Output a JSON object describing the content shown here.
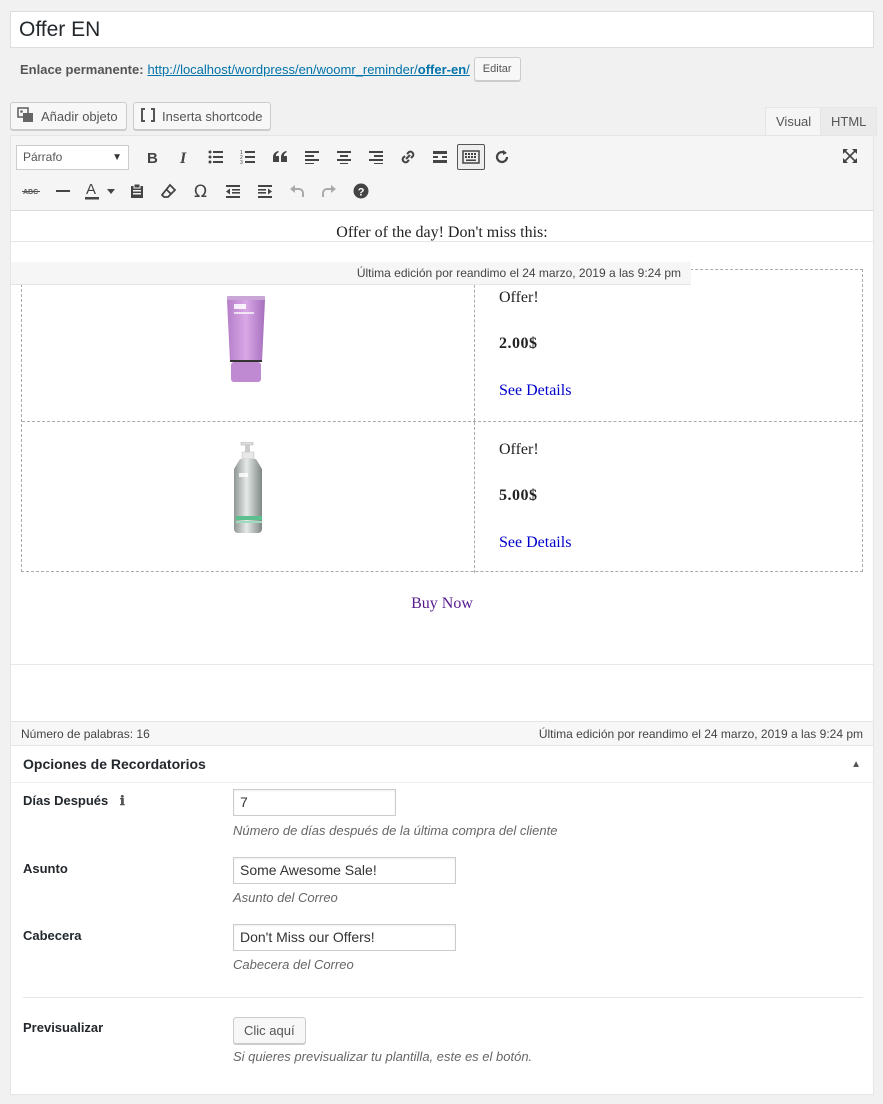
{
  "post": {
    "title": "Offer EN",
    "permalink_label": "Enlace permanente:",
    "permalink_base": "http://localhost/wordpress/en/woomr_reminder/",
    "permalink_slug": "offer-en",
    "permalink_end": "/",
    "edit_slug_label": "Editar"
  },
  "media_buttons": {
    "add_media": "Añadir objeto",
    "shortcode": "Inserta shortcode"
  },
  "editor_tabs": {
    "visual": "Visual",
    "html": "HTML"
  },
  "toolbar": {
    "format_value": "Párrafo",
    "row1": [
      "bold-icon",
      "italic-icon",
      "bulleted-list-icon",
      "numbered-list-icon",
      "blockquote-icon",
      "align-left-icon",
      "align-center-icon",
      "align-right-icon",
      "link-icon",
      "read-more-icon",
      "toolbar-toggle-icon",
      "wp-refresh-icon"
    ],
    "row2": [
      "strikethrough-icon",
      "horizontal-line-icon",
      "text-color-icon",
      "paste-as-text-icon",
      "clear-formatting-icon",
      "special-character-icon",
      "outdent-icon",
      "indent-icon",
      "undo-icon",
      "redo-icon",
      "help-icon"
    ]
  },
  "content": {
    "heading": "Offer of the day! Don't miss this:",
    "last_edit_note": "Última edición por reandimo el 24 marzo, 2019 a las 9:24 pm",
    "products": [
      {
        "title": "Offer!",
        "price": "2.00$",
        "link": "See Details",
        "image": "purple-tube-product"
      },
      {
        "title": "Offer!",
        "price": "5.00$",
        "link": "See Details",
        "image": "silver-pump-bottle-product"
      }
    ],
    "buy_now": "Buy Now"
  },
  "status_bar": {
    "word_count": "Número de palabras: 16",
    "last_edit": "Última edición por reandimo el 24 marzo, 2019 a las 9:24 pm"
  },
  "reminder_options": {
    "title": "Opciones de Recordatorios",
    "days_after": {
      "label": "Días Después",
      "value": "7",
      "description": "Número de días después de la última compra del cliente"
    },
    "subject": {
      "label": "Asunto",
      "value": "Some Awesome Sale!",
      "description": "Asunto del Correo"
    },
    "header": {
      "label": "Cabecera",
      "value": "Don't Miss our Offers!",
      "description": "Cabecera del Correo"
    },
    "preview": {
      "label": "Previsualizar",
      "button": "Clic aquí",
      "description": "Si quieres previsualizar tu plantilla, este es el botón."
    }
  },
  "colors": {
    "link": "#0073aa",
    "content_link": "#0000cc",
    "buy_now": "#551a8b"
  }
}
